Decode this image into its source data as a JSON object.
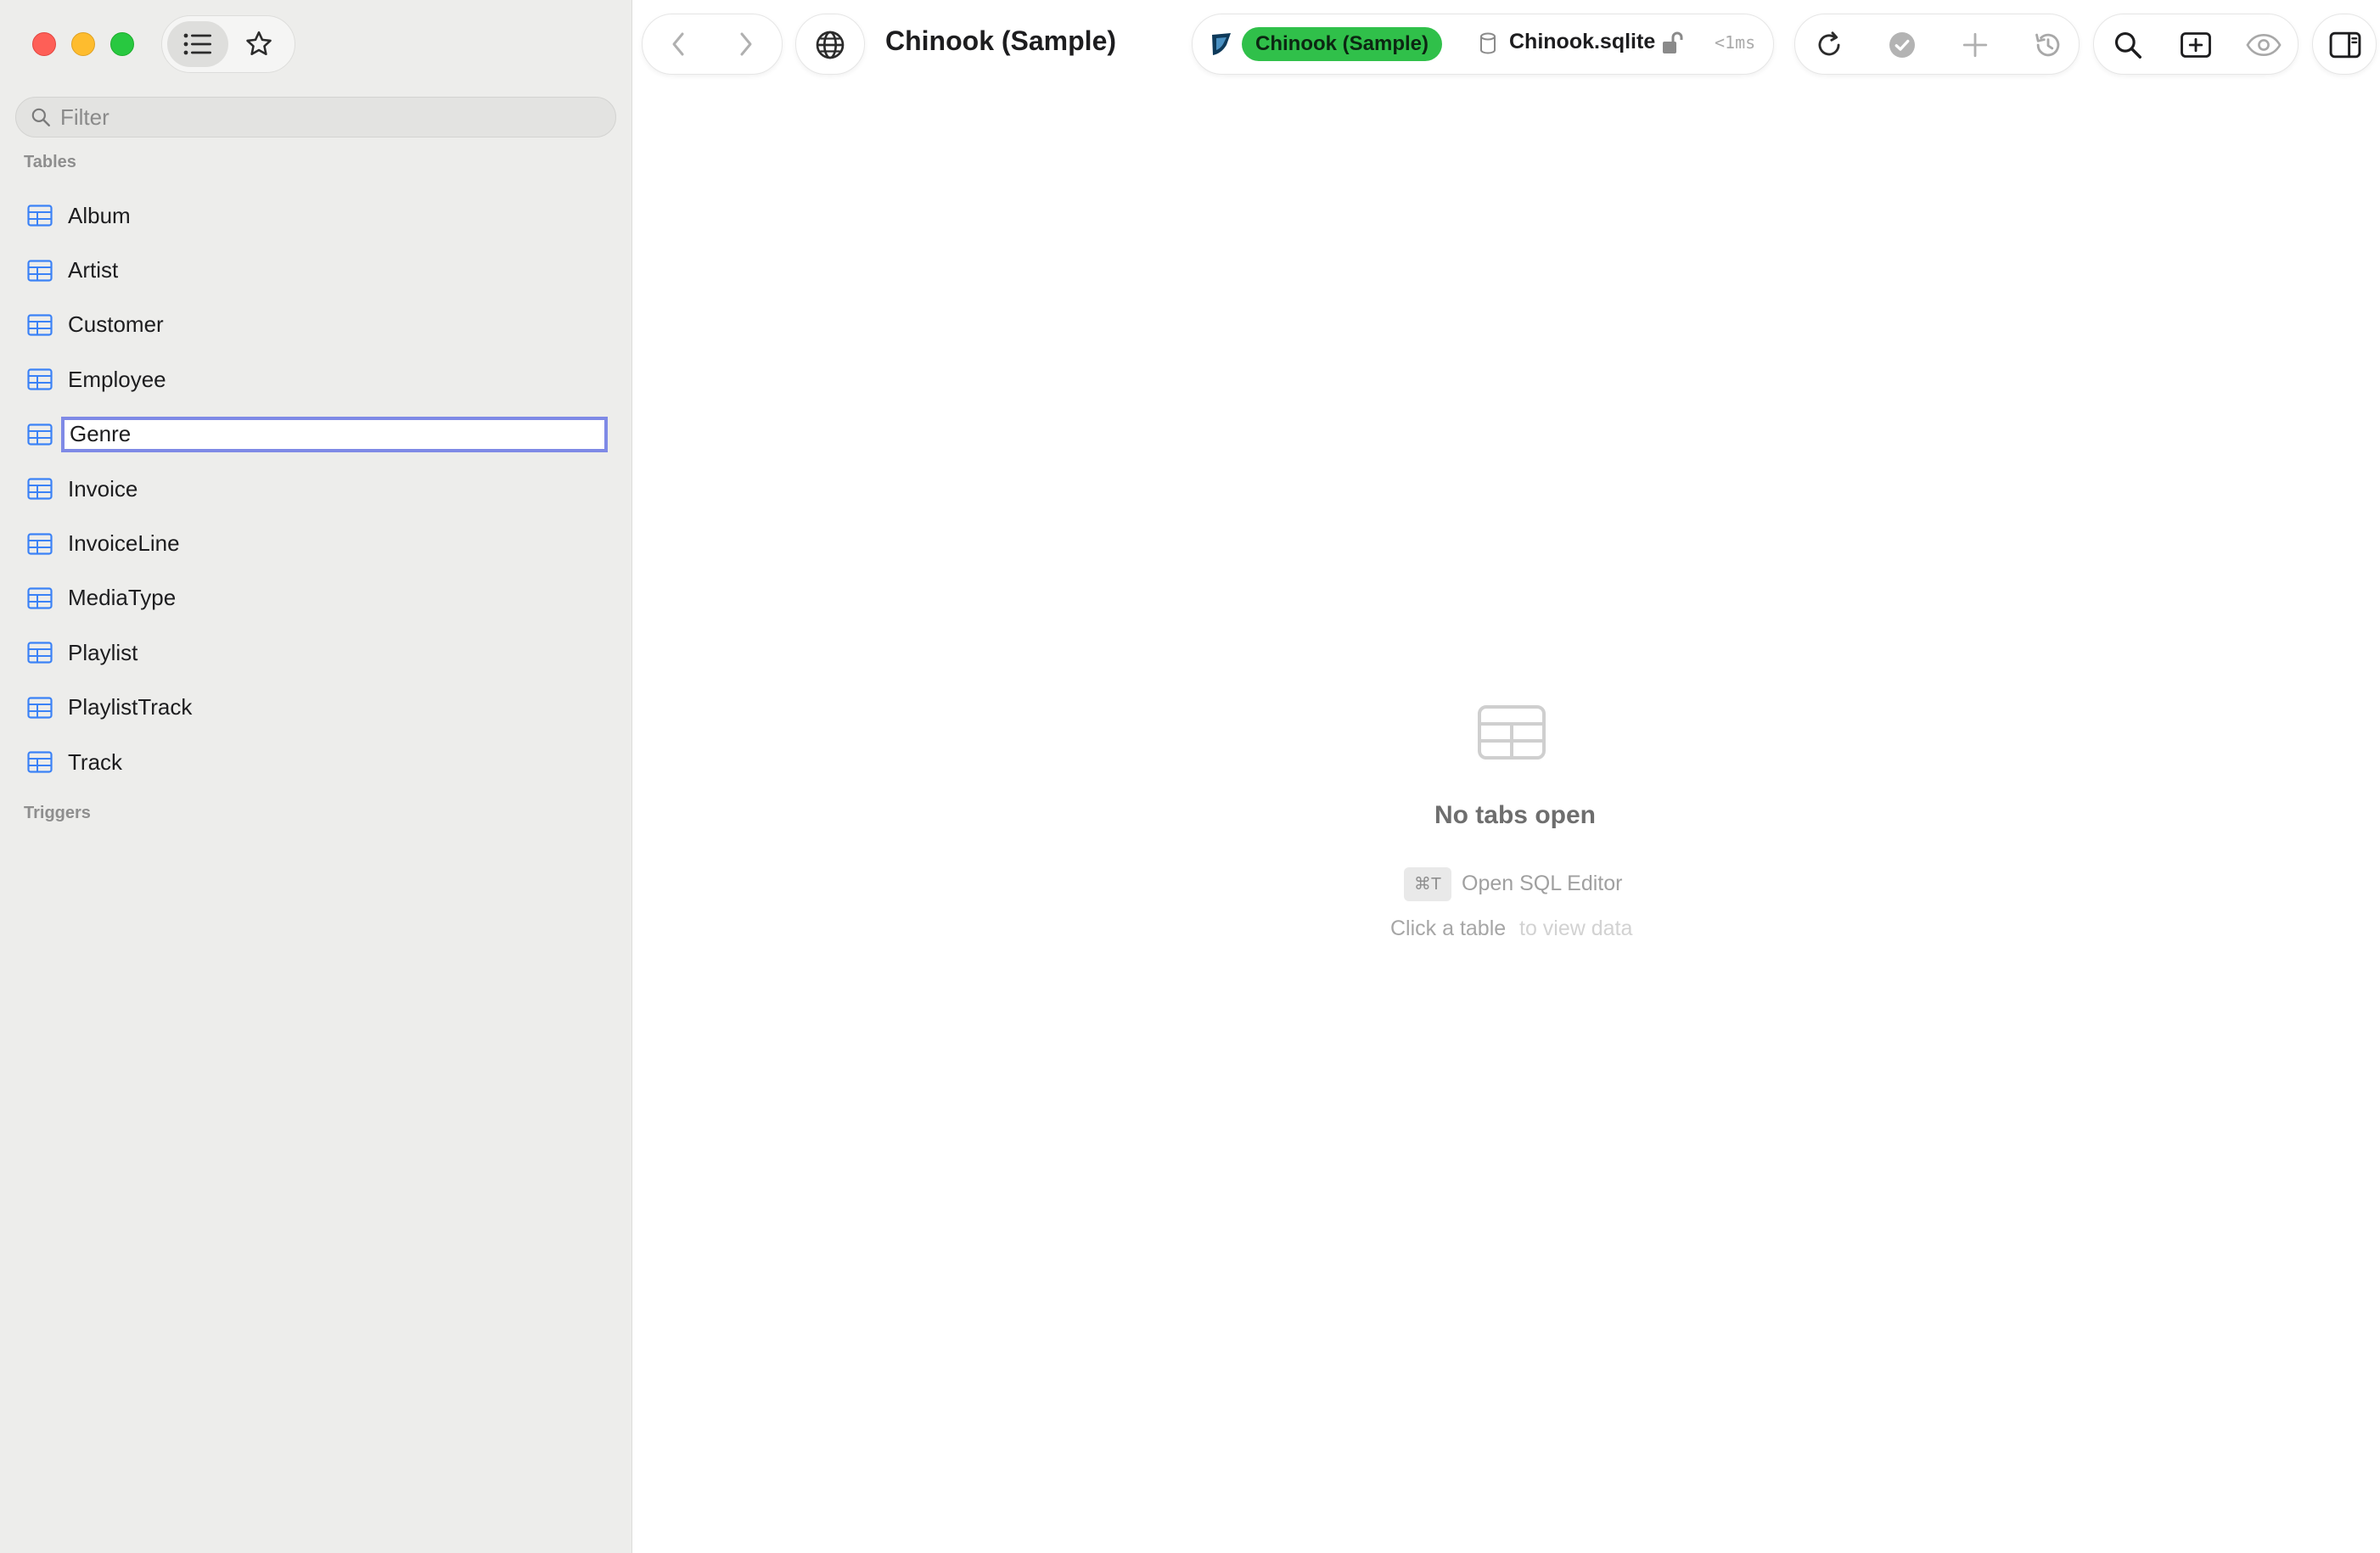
{
  "window": {
    "traffic_lights": {
      "close_color": "#fe5f57",
      "minimize_color": "#febc2e",
      "zoom_color": "#28c840"
    }
  },
  "sidebar": {
    "view_toggle": {
      "list_icon": "list-icon",
      "favorites_icon": "star-icon"
    },
    "filter": {
      "placeholder": "Filter",
      "value": ""
    },
    "tables_header": "Tables",
    "tables": [
      {
        "label": "Album"
      },
      {
        "label": "Artist"
      },
      {
        "label": "Customer"
      },
      {
        "label": "Employee"
      },
      {
        "label": "Genre",
        "editing": true
      },
      {
        "label": "Invoice"
      },
      {
        "label": "InvoiceLine"
      },
      {
        "label": "MediaType"
      },
      {
        "label": "Playlist"
      },
      {
        "label": "PlaylistTrack"
      },
      {
        "label": "Track"
      }
    ],
    "triggers_header": "Triggers"
  },
  "toolbar": {
    "title": "Chinook (Sample)",
    "connection": {
      "badge": "Chinook (Sample)",
      "badge_color": "#30c04a",
      "database_file": "Chinook.sqlite",
      "timing": "<1ms"
    },
    "icons": [
      "back-icon",
      "forward-icon",
      "globe-icon",
      "refresh-icon",
      "check-icon",
      "plus-icon",
      "history-icon",
      "search-icon",
      "new-tab-icon",
      "eye-icon",
      "sidebar-toggle-icon"
    ]
  },
  "empty_state": {
    "title": "No tabs open",
    "shortcut": "⌘T",
    "shortcut_label": "Open SQL Editor",
    "click_hint": "Click a table",
    "click_hint_suffix": "to view data"
  }
}
